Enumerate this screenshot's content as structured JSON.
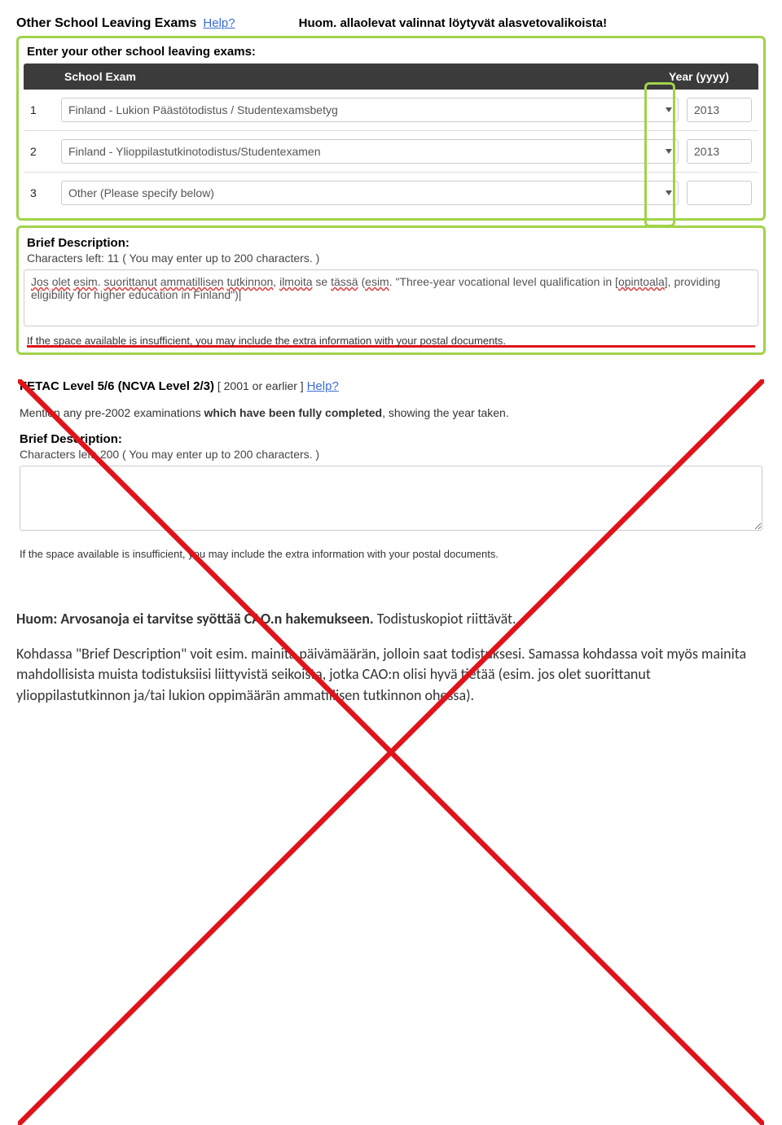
{
  "header": {
    "title": "Other School Leaving Exams",
    "help": "Help?",
    "note": "Huom. allaolevat valinnat löytyvät alasvetovalikoista!"
  },
  "exams": {
    "prompt": "Enter your other school leaving exams:",
    "th_exam": "School Exam",
    "th_year": "Year (yyyy)",
    "rows": [
      {
        "num": "1",
        "exam": "Finland - Lukion Päästötodistus / Studentexamsbetyg",
        "year": "2013"
      },
      {
        "num": "2",
        "exam": "Finland - Ylioppilastutkinotodistus/Studentexamen",
        "year": "2013"
      },
      {
        "num": "3",
        "exam": "Other (Please specify below)",
        "year": ""
      }
    ]
  },
  "desc1": {
    "label": "Brief Description:",
    "chars": "Characters left: 11 ( You may enter up to 200 characters. )",
    "text_plain": "Jos olet esim. suorittanut ammatillisen tutkinnon, ilmoita se tässä (esim. \"Three-year vocational level qualification in [opintoala], providing eligibility for higher education in Finland\")|",
    "footnote": "If the space available is insufficient, you may include the extra information with your postal documents."
  },
  "section2": {
    "title_a": "FETAC Level 5/6 (NCVA Level 2/3)",
    "title_b": " [ 2001 or earlier ]  ",
    "help": "Help?",
    "sub_a": "Mention any pre-2002 examinations ",
    "sub_b": "which have been fully completed",
    "sub_c": ", showing the year taken.",
    "desc_label": "Brief Description:",
    "chars": "Characters left: 200 ( You may enter up to 200 characters. )",
    "text": "",
    "footnote": "If the space available is insufficient, you may include the extra information with your postal documents."
  },
  "doc": {
    "p1a": "Huom: Arvosanoja ei tarvitse syöttää CAO.n hakemukseen.",
    "p1b": " Todistuskopiot riittävät.",
    "p2": "Kohdassa \"Brief Description\" voit esim. mainita päivämäärän, jolloin saat todistuksesi. Samassa kohdassa voit myös mainita mahdollisista muista todistuksiisi liittyvistä seikoista, jotka CAO:n olisi hyvä tietää (esim. jos olet suorittanut ylioppilastutkinnon ja/tai lukion oppimäärän ammatillisen tutkinnon ohessa)."
  }
}
